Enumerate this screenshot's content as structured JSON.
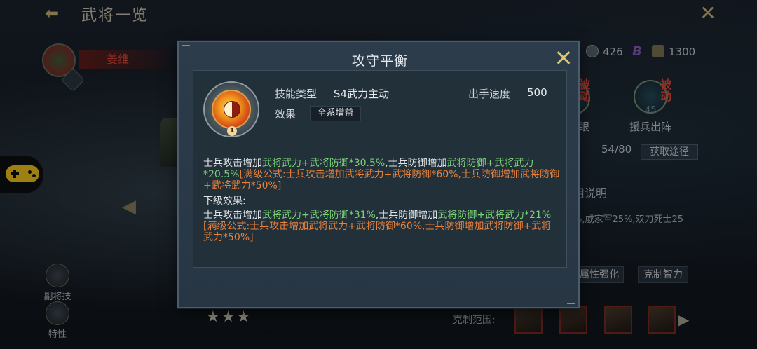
{
  "background": {
    "page_title": "武将一览",
    "hero_name": "姜维",
    "resources": [
      {
        "name": "shield-currency",
        "value": "426",
        "color": "#6f7f86"
      },
      {
        "name": "b-currency",
        "value": "B",
        "color": "#7d4fb0"
      },
      {
        "name": "soldier-currency",
        "value": "1300",
        "color": "#8a7d5a"
      }
    ],
    "skills": [
      {
        "tag": "被动",
        "label": "眼"
      },
      {
        "tag": "被动",
        "label": "援兵出阵",
        "level": "45"
      }
    ],
    "fragments": "54/80",
    "get_button": "获取途径",
    "desc_title": "用说明",
    "desc_text": "%,戚家军25%,双刀死士25",
    "tags": [
      "属性强化",
      "克制智力"
    ],
    "counter_label": "克制范围:",
    "side_items": [
      {
        "label": "副将技"
      },
      {
        "label": "特性"
      }
    ],
    "stars": "★★★"
  },
  "modal": {
    "title": "攻守平衡",
    "skill_type_label": "技能类型",
    "skill_type_value": "S4武力主动",
    "speed_label": "出手速度",
    "speed_value": "500",
    "effect_label": "效果",
    "effect_value": "全系增益",
    "skill_level": "1",
    "current_effect": {
      "t1": "士兵攻击增加",
      "g1": "武将武力+武将防御*30.5%",
      "t2": ",士兵防御增加",
      "g2": "武将防御+武将武力*20.5%",
      "o1": "[满级公式:士兵攻击增加武将武力+武将防御*60%,士兵防御增加武将防御+武将武力*50%]"
    },
    "next_label": "下级效果:",
    "next_effect": {
      "t1": "士兵攻击增加",
      "g1": "武将武力+武将防御*31%",
      "t2": ",士兵防御增加",
      "g2": "武将防御+武将武力*21%",
      "o1": "[满级公式:士兵攻击增加武将武力+武将防御*60%,士兵防御增加武将防御+武将武力*50%]"
    },
    "colors": {
      "highlight_green": "#7dd07a",
      "highlight_orange": "#e8813c",
      "close_gold": "#e0c66d"
    }
  }
}
